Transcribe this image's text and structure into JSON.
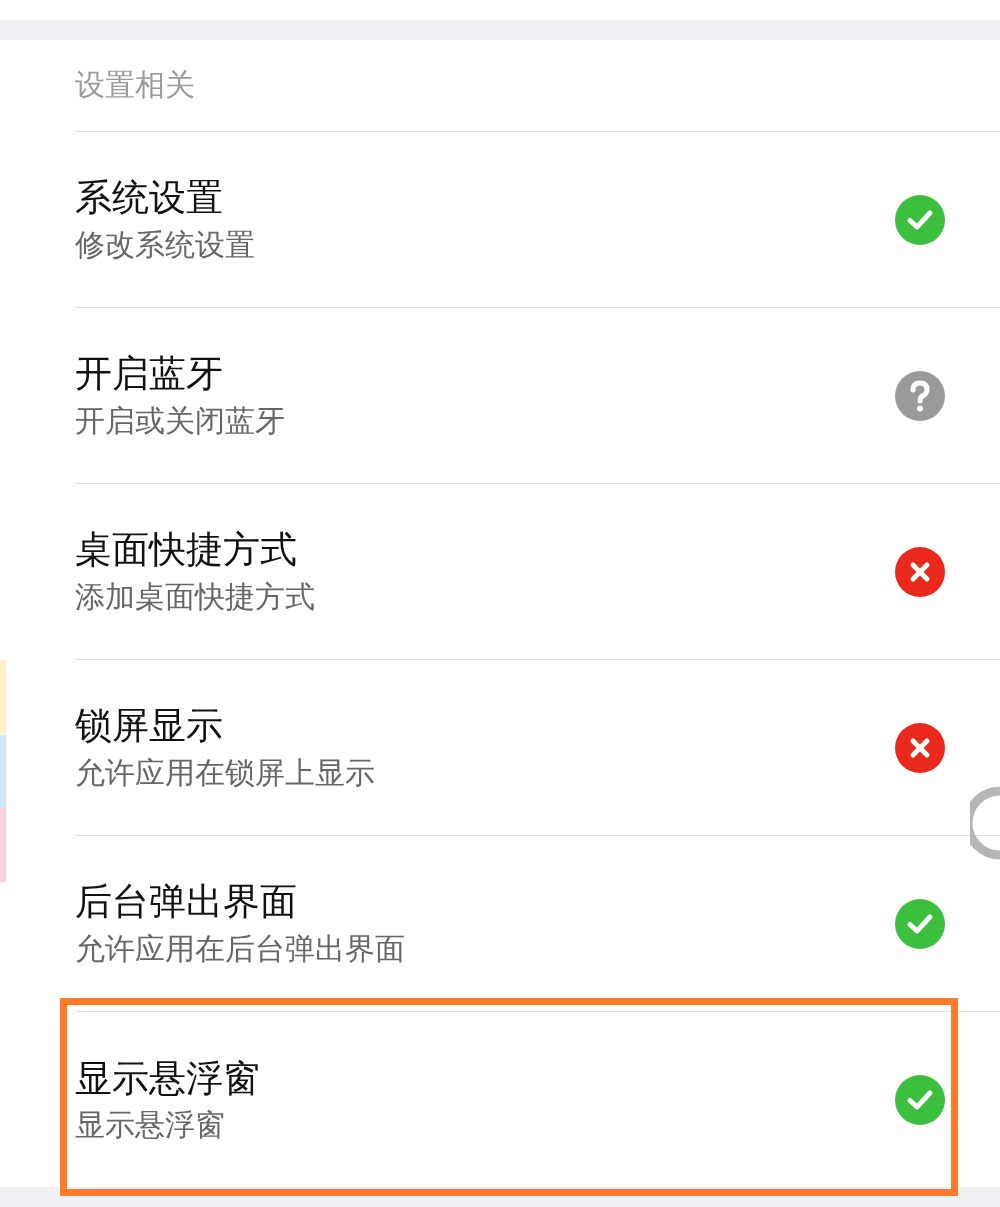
{
  "section": {
    "header": "设置相关"
  },
  "rows": [
    {
      "title": "系统设置",
      "subtitle": "修改系统设置",
      "kind": "allowed",
      "highlighted": false
    },
    {
      "title": "开启蓝牙",
      "subtitle": "开启或关闭蓝牙",
      "kind": "ask",
      "highlighted": false
    },
    {
      "title": "桌面快捷方式",
      "subtitle": "添加桌面快捷方式",
      "kind": "denied",
      "highlighted": false
    },
    {
      "title": "锁屏显示",
      "subtitle": "允许应用在锁屏上显示",
      "kind": "denied",
      "highlighted": false
    },
    {
      "title": "后台弹出界面",
      "subtitle": "允许应用在后台弹出界面",
      "kind": "allowed",
      "highlighted": false
    },
    {
      "title": "显示悬浮窗",
      "subtitle": "显示悬浮窗",
      "kind": "allowed",
      "highlighted": true
    }
  ]
}
